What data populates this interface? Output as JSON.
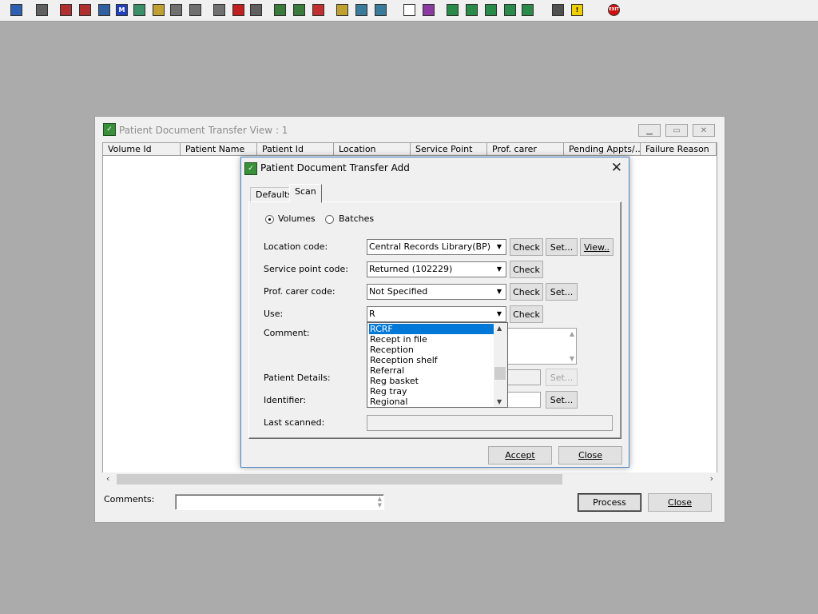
{
  "toolbar": {
    "icons": [
      {
        "name": "user-icon",
        "glyph": "",
        "color": "#2f5fb0"
      },
      {
        "name": "printer-icon",
        "glyph": "",
        "color": "#606060"
      },
      {
        "name": "books-icon",
        "glyph": "",
        "color": "#b03030"
      },
      {
        "name": "edit-note-icon",
        "glyph": "",
        "color": "#b03030"
      },
      {
        "name": "document-view-icon",
        "glyph": "",
        "color": "#3060a0"
      },
      {
        "name": "letter-m-icon",
        "glyph": "M",
        "color": "#2040c0"
      },
      {
        "name": "person-icon",
        "glyph": "",
        "color": "#3a8f6a"
      },
      {
        "name": "pencil-note-icon",
        "glyph": "",
        "color": "#c0a030"
      },
      {
        "name": "transfer-icon",
        "glyph": "",
        "color": "#707070"
      },
      {
        "name": "transfer-alt-icon",
        "glyph": "",
        "color": "#707070"
      },
      {
        "name": "mail-icon",
        "glyph": "",
        "color": "#707070"
      },
      {
        "name": "clock-icon",
        "glyph": "",
        "color": "#c02020"
      },
      {
        "name": "list-box-icon",
        "glyph": "",
        "color": "#606060"
      },
      {
        "name": "screen-person-icon",
        "glyph": "",
        "color": "#3a7a3a"
      },
      {
        "name": "screen-edit-icon",
        "glyph": "",
        "color": "#3a7a3a"
      },
      {
        "name": "cycle-icon",
        "glyph": "",
        "color": "#c03030"
      },
      {
        "name": "notepad-icon",
        "glyph": "",
        "color": "#c0a030"
      },
      {
        "name": "stack-icon",
        "glyph": "",
        "color": "#3a7a9a"
      },
      {
        "name": "stack-alt-icon",
        "glyph": "",
        "color": "#3a7a9a"
      },
      {
        "name": "blank-page-icon",
        "glyph": "",
        "color": "#ffffff"
      },
      {
        "name": "bar-chart-icon",
        "glyph": "",
        "color": "#8a3aa0"
      },
      {
        "name": "globe-icon",
        "glyph": "",
        "color": "#2a8a4a"
      },
      {
        "name": "checklist-icon",
        "glyph": "",
        "color": "#2a8a4a"
      },
      {
        "name": "checklist-pd-icon",
        "glyph": "",
        "color": "#2a8a4a"
      },
      {
        "name": "check-arrow-icon",
        "glyph": "",
        "color": "#2a8a4a"
      },
      {
        "name": "check-arrow-alt-icon",
        "glyph": "",
        "color": "#2a8a4a"
      },
      {
        "name": "swap-icon",
        "glyph": "",
        "color": "#505050"
      },
      {
        "name": "warning-icon",
        "glyph": "!",
        "color": "#f0d000"
      },
      {
        "name": "exit-icon",
        "glyph": "EXIT",
        "color": "#d01010"
      }
    ]
  },
  "main_window": {
    "title": "Patient Document Transfer View : 1",
    "columns": [
      "Volume Id",
      "Patient Name",
      "Patient Id",
      "Location",
      "Service Point",
      "Prof. carer",
      "Pending Appts/...",
      "Failure Reason"
    ],
    "comments_label": "Comments:",
    "comments_value": "",
    "process_label": "Process",
    "close_label": "Close"
  },
  "dialog": {
    "title": "Patient Document Transfer Add",
    "tabs": [
      {
        "label": "Defaults"
      },
      {
        "label": "Scan"
      }
    ],
    "active_tab": "Scan",
    "radio_volumes": "Volumes",
    "radio_batches": "Batches",
    "selected_radio": "Volumes",
    "fields": {
      "location_code": {
        "label": "Location code:",
        "value": "Central Records Library(BP)"
      },
      "service_point_code": {
        "label": "Service point code:",
        "value": "Returned (102229)"
      },
      "prof_carer_code": {
        "label": "Prof. carer code:",
        "value": "Not Specified"
      },
      "use": {
        "label": "Use:",
        "value": "R"
      },
      "comment": {
        "label": "Comment:",
        "value": ""
      },
      "patient_details": {
        "label": "Patient Details:",
        "value": ""
      },
      "identifier": {
        "label": "Identifier:",
        "value": ""
      },
      "last_scanned": {
        "label": "Last scanned:",
        "value": ""
      }
    },
    "buttons": {
      "check": "Check",
      "set": "Set...",
      "view": "View..",
      "accept": "Accept",
      "close": "Close"
    },
    "use_dropdown": {
      "items": [
        "RCRF",
        "Recept in file",
        "Reception",
        "Reception shelf",
        "Referral",
        "Reg basket",
        "Reg tray",
        "Regional"
      ],
      "selected": "RCRF"
    }
  }
}
